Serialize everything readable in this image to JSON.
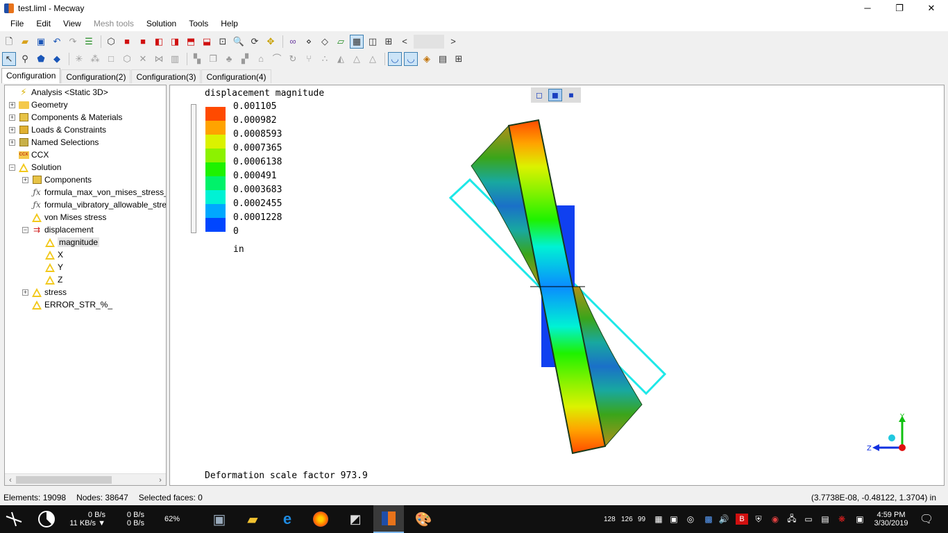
{
  "window": {
    "title": "test.liml - Mecway",
    "controls": {
      "minimize": "─",
      "maximize": "❐",
      "close": "✕"
    }
  },
  "menu": [
    "File",
    "Edit",
    "View",
    "Mesh tools",
    "Solution",
    "Tools",
    "Help"
  ],
  "menu_disabled": [
    "Mesh tools"
  ],
  "toolbar1": {
    "icons": [
      "new-icon",
      "open-icon",
      "save-icon",
      "undo-icon",
      "redo-icon",
      "layers-icon",
      "cube-wireframe-icon",
      "view-front-icon",
      "view-back-icon",
      "view-left-icon",
      "view-right-icon",
      "view-top-icon",
      "view-bottom-icon",
      "zoom-fit-icon",
      "zoom-icon",
      "rotate-icon",
      "pan-icon",
      "glasses-icon",
      "node-select-icon",
      "element-icon",
      "surface-icon",
      "shaded-icon",
      "wireframe-icon",
      "mesh-icon"
    ],
    "scroll_left": "<",
    "scroll_right": ">"
  },
  "toolbar2": {
    "icons": [
      "select-arrow-icon",
      "select-node-icon",
      "select-face-icon",
      "select-element-icon",
      "explode-icon",
      "shrink-icon",
      "square-icon",
      "cube-outline-icon",
      "delete-icon",
      "mirror-icon",
      "grid-icon",
      "move-icon",
      "copy-icon",
      "scale-icon",
      "tower-icon",
      "bend-icon",
      "sweep-icon",
      "refine-icon",
      "coarsen-icon",
      "triangle-icon",
      "warning-triangle-icon",
      "deform-icon",
      "deform-animate-icon",
      "show-elements-icon",
      "film-icon",
      "table-icon"
    ]
  },
  "tabs": [
    "Configuration",
    "Configuration(2)",
    "Configuration(3)",
    "Configuration(4)"
  ],
  "tree": [
    {
      "label": "Analysis <Static 3D>",
      "icon": "lightning-icon",
      "indent": 0,
      "expander": ""
    },
    {
      "label": "Geometry",
      "icon": "folder-icon",
      "indent": 0,
      "expander": "+"
    },
    {
      "label": "Components & Materials",
      "icon": "component-icon",
      "indent": 0,
      "expander": "+"
    },
    {
      "label": "Loads & Constraints",
      "icon": "loads-icon",
      "indent": 0,
      "expander": "+"
    },
    {
      "label": "Named Selections",
      "icon": "named-selection-icon",
      "indent": 0,
      "expander": "+"
    },
    {
      "label": "CCX",
      "icon": "ccx-icon",
      "indent": 0,
      "expander": ""
    },
    {
      "label": "Solution",
      "icon": "solution-icon",
      "indent": 0,
      "expander": "−"
    },
    {
      "label": "Components",
      "icon": "component-icon",
      "indent": 1,
      "expander": "+"
    },
    {
      "label": "formula_max_von_mises_stress_",
      "icon": "formula-icon",
      "indent": 1,
      "expander": ""
    },
    {
      "label": "formula_vibratory_allowable_stre",
      "icon": "formula-icon",
      "indent": 1,
      "expander": ""
    },
    {
      "label": "von Mises stress",
      "icon": "result-icon",
      "indent": 1,
      "expander": ""
    },
    {
      "label": "displacement",
      "icon": "displacement-icon",
      "indent": 1,
      "expander": "−"
    },
    {
      "label": "magnitude",
      "icon": "result-icon",
      "indent": 2,
      "expander": "",
      "selected": true
    },
    {
      "label": "X",
      "icon": "result-icon",
      "indent": 2,
      "expander": ""
    },
    {
      "label": "Y",
      "icon": "result-icon",
      "indent": 2,
      "expander": ""
    },
    {
      "label": "Z",
      "icon": "result-icon",
      "indent": 2,
      "expander": ""
    },
    {
      "label": "stress",
      "icon": "result-icon",
      "indent": 1,
      "expander": "+"
    },
    {
      "label": "ERROR_STR_%_",
      "icon": "result-icon",
      "indent": 1,
      "expander": ""
    }
  ],
  "legend": {
    "title": "displacement magnitude",
    "values": [
      "0.001105",
      "0.000982",
      "0.0008593",
      "0.0007365",
      "0.0006138",
      "0.000491",
      "0.0003683",
      "0.0002455",
      "0.0001228",
      "0"
    ],
    "colors": [
      "#ff4a00",
      "#ffa300",
      "#dbf200",
      "#8cf200",
      "#1ef200",
      "#00f26a",
      "#00f2d4",
      "#00a8ff",
      "#0046ff"
    ],
    "units": "in"
  },
  "scale_factor_text": "Deformation scale factor 973.9",
  "axes": {
    "y": "Y",
    "z": "Z"
  },
  "status": {
    "elements": "Elements: 19098",
    "nodes": "Nodes: 38647",
    "selected": "Selected faces: 0",
    "coords": "(3.7738E-08, -0.48122, 1.3704) in"
  },
  "taskbar": {
    "net_up_down_1": "0 B/s",
    "net_up_down_2": "11 KB/s ▼",
    "net_3": "0 B/s",
    "net_4": "0 B/s",
    "cpu": "62%",
    "tray_numbers": [
      "128",
      "126",
      "99"
    ],
    "time": "4:59 PM",
    "date": "3/30/2019"
  }
}
